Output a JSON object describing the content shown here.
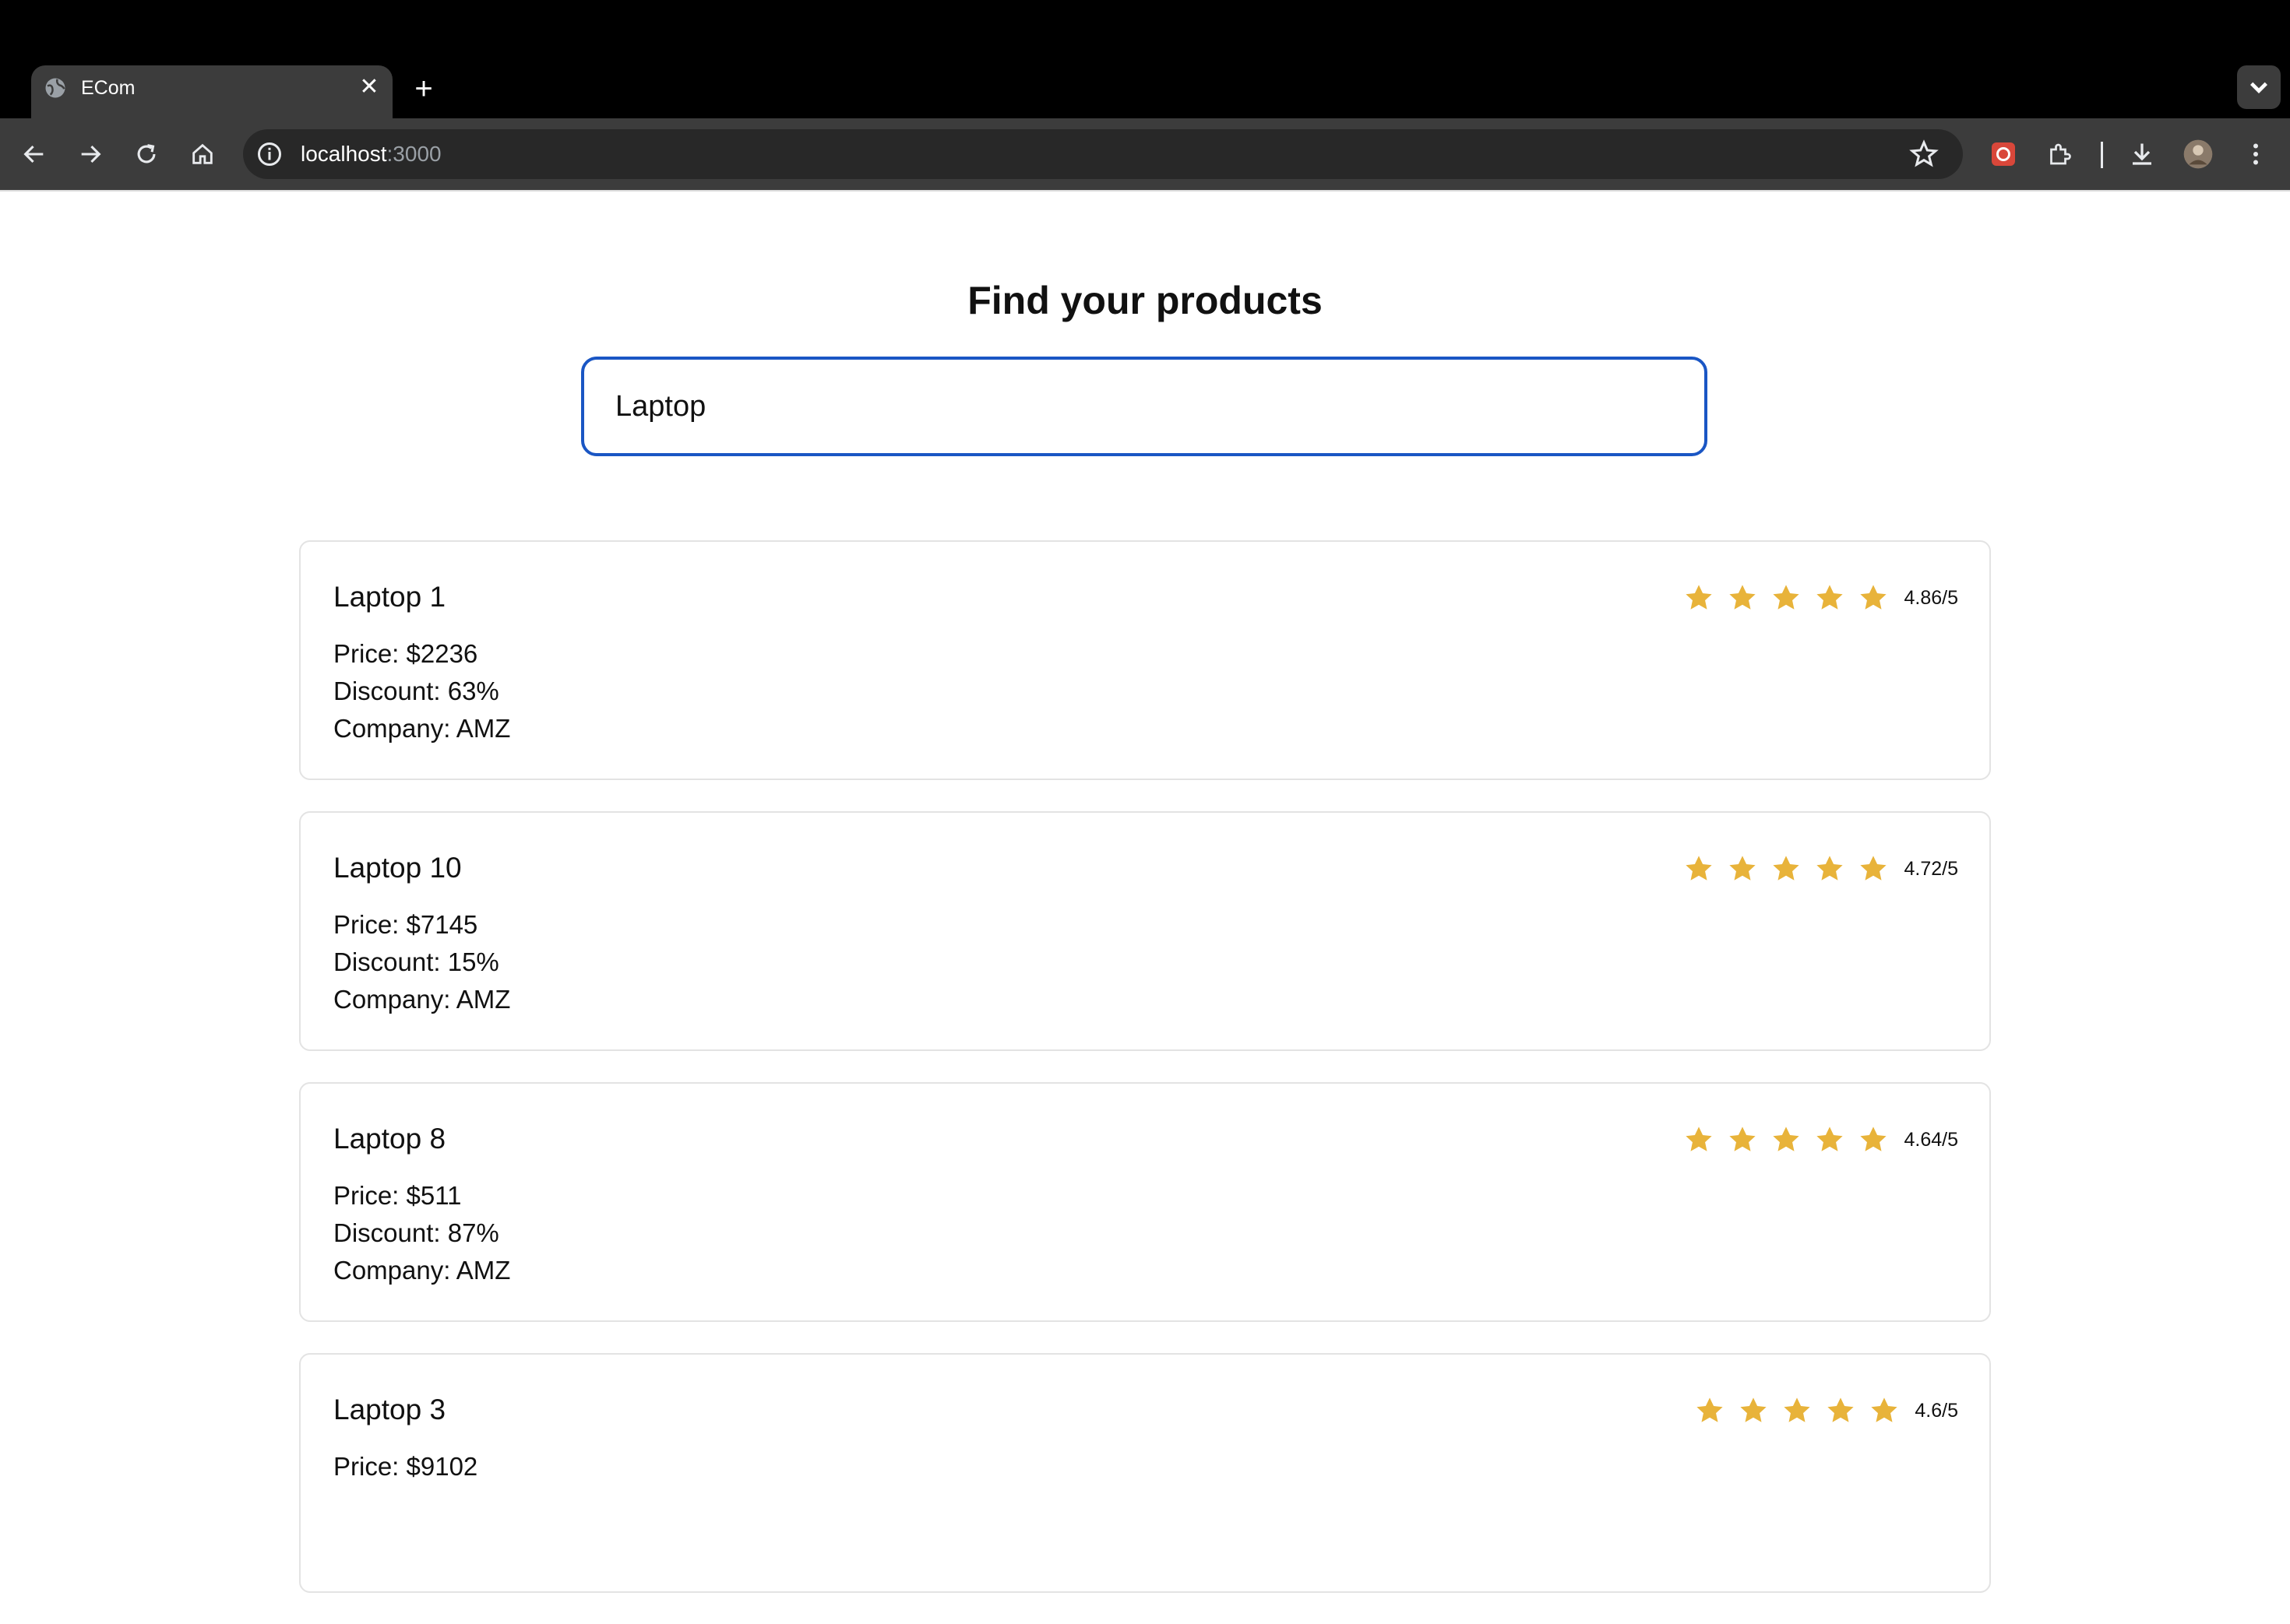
{
  "browser": {
    "tab_title": "ECom",
    "url_host": "localhost",
    "url_port": ":3000"
  },
  "page": {
    "title": "Find your products",
    "search": {
      "value": "Laptop",
      "placeholder": ""
    }
  },
  "products": [
    {
      "name": "Laptop 1",
      "price": "Price: $2236",
      "discount": "Discount: 63%",
      "company": "Company: AMZ",
      "rating": "4.86/5",
      "stars": 5
    },
    {
      "name": "Laptop 10",
      "price": "Price: $7145",
      "discount": "Discount: 15%",
      "company": "Company: AMZ",
      "rating": "4.72/5",
      "stars": 5
    },
    {
      "name": "Laptop 8",
      "price": "Price: $511",
      "discount": "Discount: 87%",
      "company": "Company: AMZ",
      "rating": "4.64/5",
      "stars": 5
    },
    {
      "name": "Laptop 3",
      "price": "Price: $9102",
      "discount": "",
      "company": "",
      "rating": "4.6/5",
      "stars": 5
    }
  ],
  "colors": {
    "star": "#e8b33a",
    "search_border": "#1a56c4"
  }
}
